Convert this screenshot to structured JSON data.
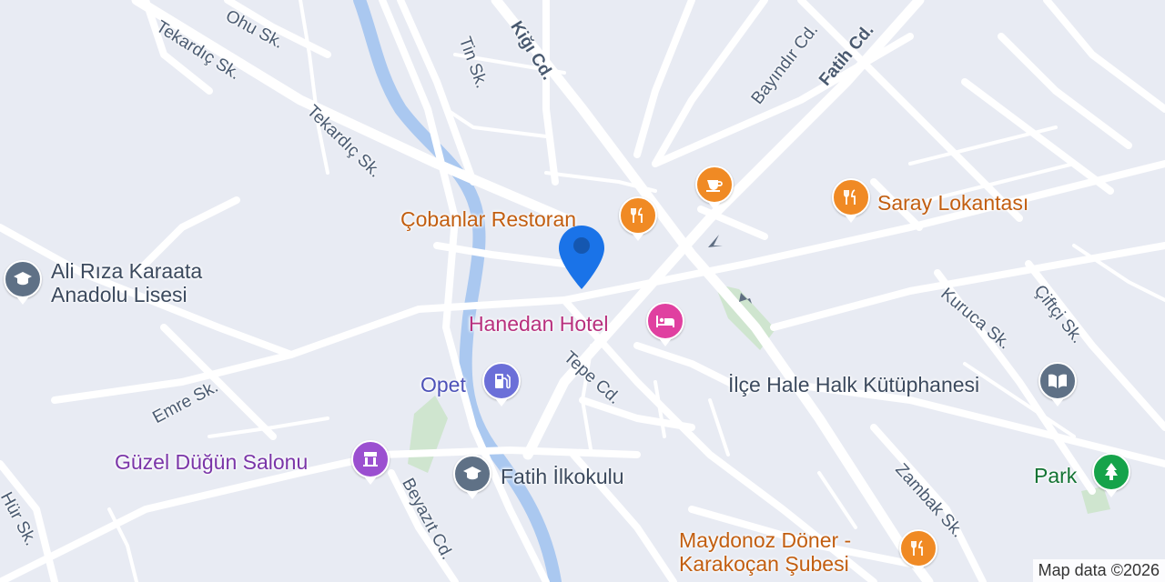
{
  "map": {
    "colors": {
      "background": "#e8ebf3",
      "road": "#ffffff",
      "water": "#aac8f0",
      "park": "#cfe5cf",
      "food": "#f08a24",
      "lodging": "#e040a0",
      "education": "#5f7186",
      "shopping": "#6b6fd8",
      "event": "#9b4fd0",
      "nature": "#16a34a",
      "location": "#1a73e8"
    },
    "streets": [
      {
        "name": "Ohu Sk."
      },
      {
        "name": "Tekardıç Sk."
      },
      {
        "name": "Tekardıç Sk."
      },
      {
        "name": "Tin Sk."
      },
      {
        "name": "Kiğı Cd."
      },
      {
        "name": "Bayındır Cd."
      },
      {
        "name": "Fatih Cd."
      },
      {
        "name": "Emre Sk."
      },
      {
        "name": "Tepe Cd."
      },
      {
        "name": "Kuruca Sk."
      },
      {
        "name": "Çiftçi Sk."
      },
      {
        "name": "Zambak Sk."
      },
      {
        "name": "Beyazıt Cd."
      },
      {
        "name": "Hür Sk."
      }
    ],
    "pois": [
      {
        "name": "Çobanlar Restoran",
        "category": "food",
        "icon": "restaurant-icon"
      },
      {
        "name": "Saray Lokantası",
        "category": "food",
        "icon": "restaurant-icon"
      },
      {
        "name": "",
        "category": "food",
        "icon": "cafe-icon"
      },
      {
        "name": "Ali Rıza Karaata\nAnadolu Lisesi",
        "category": "education",
        "icon": "school-icon"
      },
      {
        "name": "Hanedan Hotel",
        "category": "lodging",
        "icon": "hotel-icon"
      },
      {
        "name": "Opet",
        "category": "shopping",
        "icon": "gas-station-icon"
      },
      {
        "name": "İlçe Hale Halk Kütüphanesi",
        "category": "education",
        "icon": "library-icon"
      },
      {
        "name": "Güzel Düğün Salonu",
        "category": "event",
        "icon": "event-venue-icon"
      },
      {
        "name": "Fatih İlkokulu",
        "category": "education",
        "icon": "school-icon"
      },
      {
        "name": "Park",
        "category": "nature",
        "icon": "park-icon"
      },
      {
        "name": "Maydonoz Döner -\nKarakoçan Şubesi",
        "category": "food",
        "icon": "restaurant-icon"
      }
    ],
    "attribution": "Map data ©2026"
  }
}
